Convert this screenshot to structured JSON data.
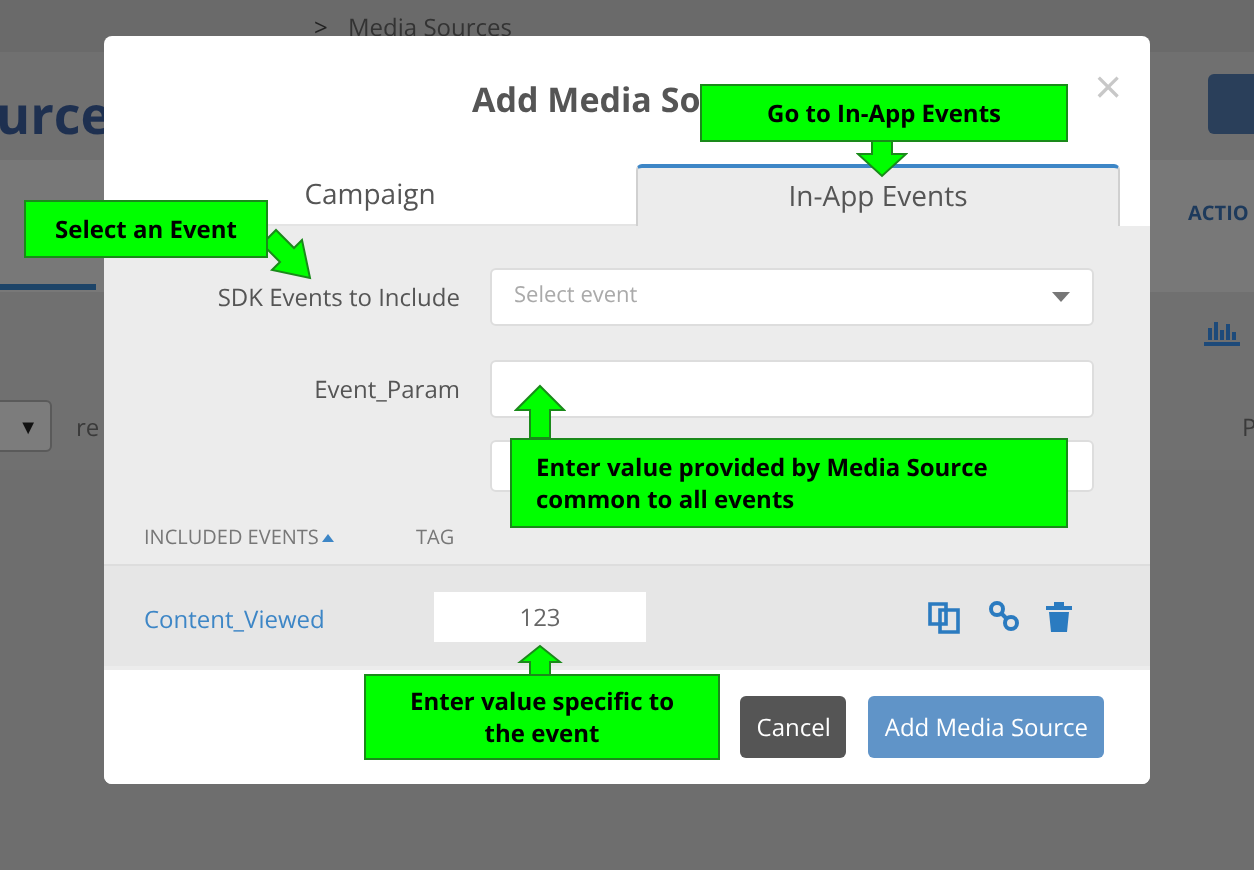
{
  "background_page": {
    "breadcrumb_separator": ">",
    "breadcrumb": "Media Sources",
    "heading": "urce",
    "column_header": "ACTIO",
    "dropdown_caret": "▼",
    "filter_text": "re",
    "column_3": "P"
  },
  "dialog": {
    "title": "Add Media So",
    "close": "×",
    "tabs": [
      {
        "label": "Campaign",
        "selected": false
      },
      {
        "label": "In-App Events",
        "selected": true
      }
    ],
    "fields": [
      {
        "label": "SDK Events to Include",
        "kind": "select",
        "placeholder": "Select event"
      },
      {
        "label": "Event_Param",
        "kind": "text"
      },
      {
        "kind": "text"
      }
    ],
    "table": {
      "columns": [
        {
          "label": "INCLUDED EVENTS",
          "sorted": true
        },
        {
          "label": "TAG",
          "sorted": false
        }
      ],
      "rows": [
        {
          "event": "Content_Viewed",
          "tag": "123"
        }
      ]
    },
    "buttons": [
      {
        "label": "Cancel",
        "kind": "secondary"
      },
      {
        "label": "Add Media Source",
        "kind": "primary"
      }
    ]
  },
  "annotations": [
    {
      "text": "Go to In-App Events"
    },
    {
      "text": "Select an Event"
    },
    {
      "text": "Enter value provided by Media Source common to all events"
    },
    {
      "text": "Enter value specific to the event"
    }
  ]
}
